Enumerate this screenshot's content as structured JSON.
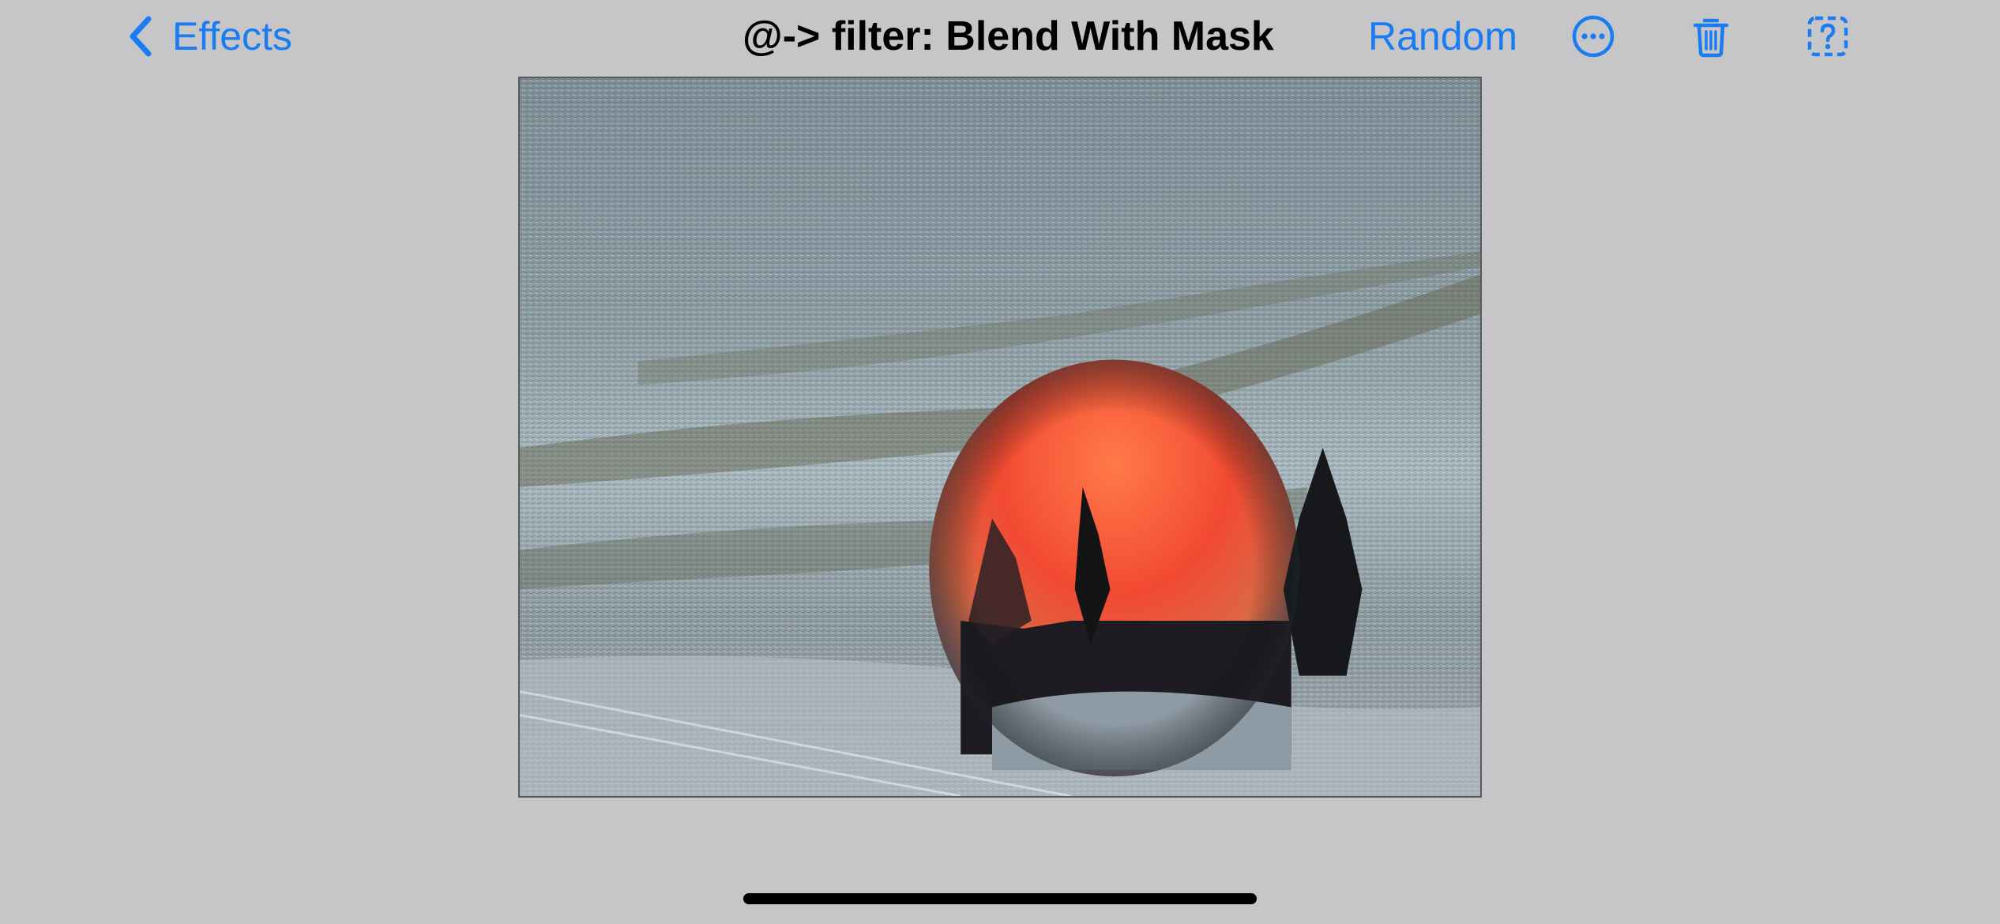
{
  "navbar": {
    "back_label": "Effects",
    "title": "@-> filter: Blend With Mask",
    "random_label": "Random",
    "icons": [
      "chevron-left-icon",
      "ellipsis-circle-icon",
      "trash-icon",
      "questionmark-dashed-square-icon"
    ]
  },
  "colors": {
    "background": "#c6c6c8",
    "accent": "#1a7cf2",
    "title": "#000000"
  },
  "preview": {
    "image_description_icon": "filtered-photo-preview"
  }
}
